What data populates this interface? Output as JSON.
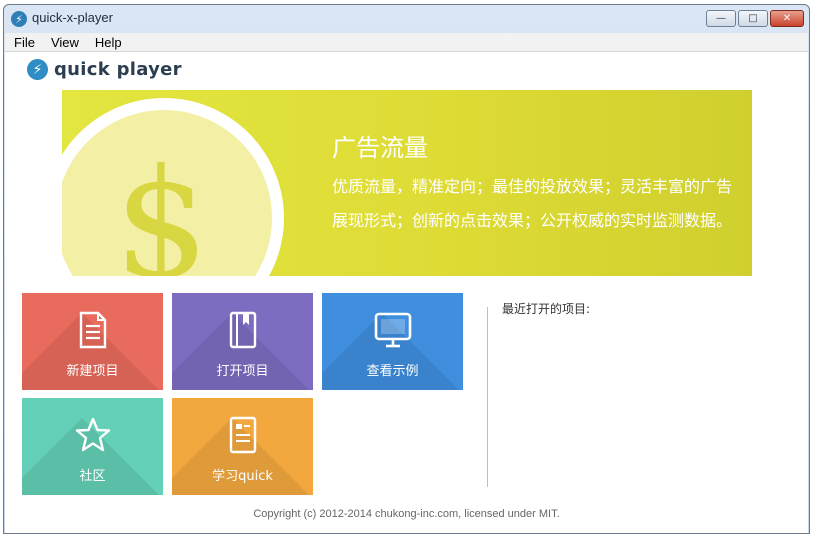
{
  "window": {
    "title": "quick-x-player",
    "controls": {
      "minimize": "—",
      "maximize": "□",
      "close": "✕"
    }
  },
  "menubar": {
    "items": [
      "File",
      "View",
      "Help"
    ]
  },
  "brand": {
    "icon": "lightning-icon",
    "name": "quick player"
  },
  "banner": {
    "title": "广告流量",
    "lines": [
      "优质流量，精准定向；最佳的投放效果；灵活丰富的广告",
      "展现形式；创新的点击效果；公开权威的实时监测数据。"
    ],
    "symbol": "$",
    "colors": {
      "background": "#e3e640",
      "coin": "#f3f0a6",
      "symbol": "#d9d741"
    }
  },
  "tiles": [
    {
      "id": "new-project",
      "label": "新建项目",
      "icon": "document-icon",
      "color": "#e96b5d"
    },
    {
      "id": "open-project",
      "label": "打开项目",
      "icon": "book-icon",
      "color": "#7d6cc0"
    },
    {
      "id": "view-samples",
      "label": "查看示例",
      "icon": "monitor-icon",
      "color": "#3f8fde"
    },
    {
      "id": "community",
      "label": "社区",
      "icon": "star-icon",
      "color": "#63d0b7"
    },
    {
      "id": "learn-quick",
      "label": "学习quick",
      "icon": "notes-icon",
      "color": "#f2a83f"
    }
  ],
  "recent": {
    "label": "最近打开的项目:"
  },
  "footer": {
    "copyright": "Copyright (c) 2012-2014 chukong-inc.com, licensed under MIT."
  }
}
